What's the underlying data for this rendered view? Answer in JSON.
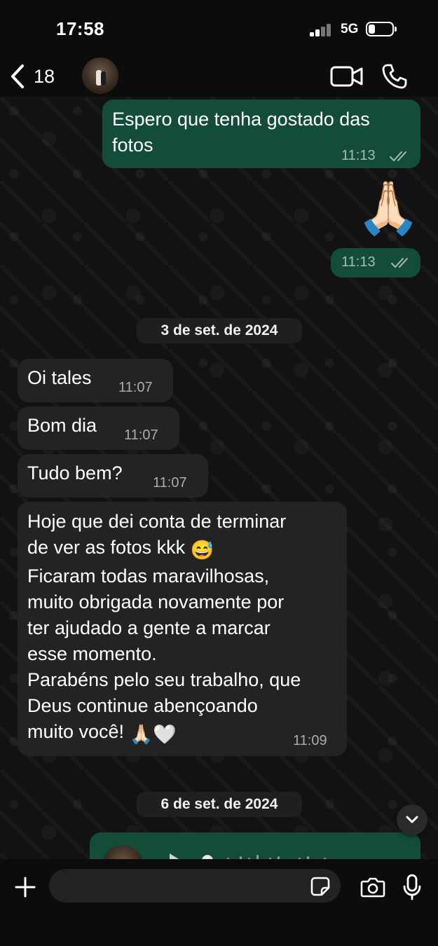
{
  "status_bar": {
    "time": "17:58",
    "network": "5G"
  },
  "header": {
    "back_count": "18"
  },
  "messages": [
    {
      "text": "Espero que tenha gostado das fotos",
      "time": "11:13"
    },
    {
      "emoji": "🙏🏻",
      "time": "11:13"
    },
    {
      "date": "3 de set. de 2024"
    },
    {
      "text": "Oi tales",
      "time": "11:07"
    },
    {
      "text": "Bom dia",
      "time": "11:07"
    },
    {
      "text": "Tudo bem?",
      "time": "11:07"
    },
    {
      "text": "Hoje que dei conta de terminar\nde ver as fotos kkk",
      "emoji_1": "😅",
      "text_2": "\nFicaram todas maravilhosas,\nmuito obrigada novamente por\nter ajudado a gente a marcar\nesse momento.\nParabéns pelo seu trabalho, que\nDeus continue abençoando\nmuito você!",
      "emoji_2": "🙏🏻🤍",
      "time": "11:09"
    },
    {
      "date": "6 de set. de 2024"
    }
  ],
  "colors": {
    "outgoing_bubble": "#144d37",
    "incoming_bubble": "#232323",
    "read_ticks": "#a9b8b0"
  },
  "input": {
    "placeholder": ""
  }
}
